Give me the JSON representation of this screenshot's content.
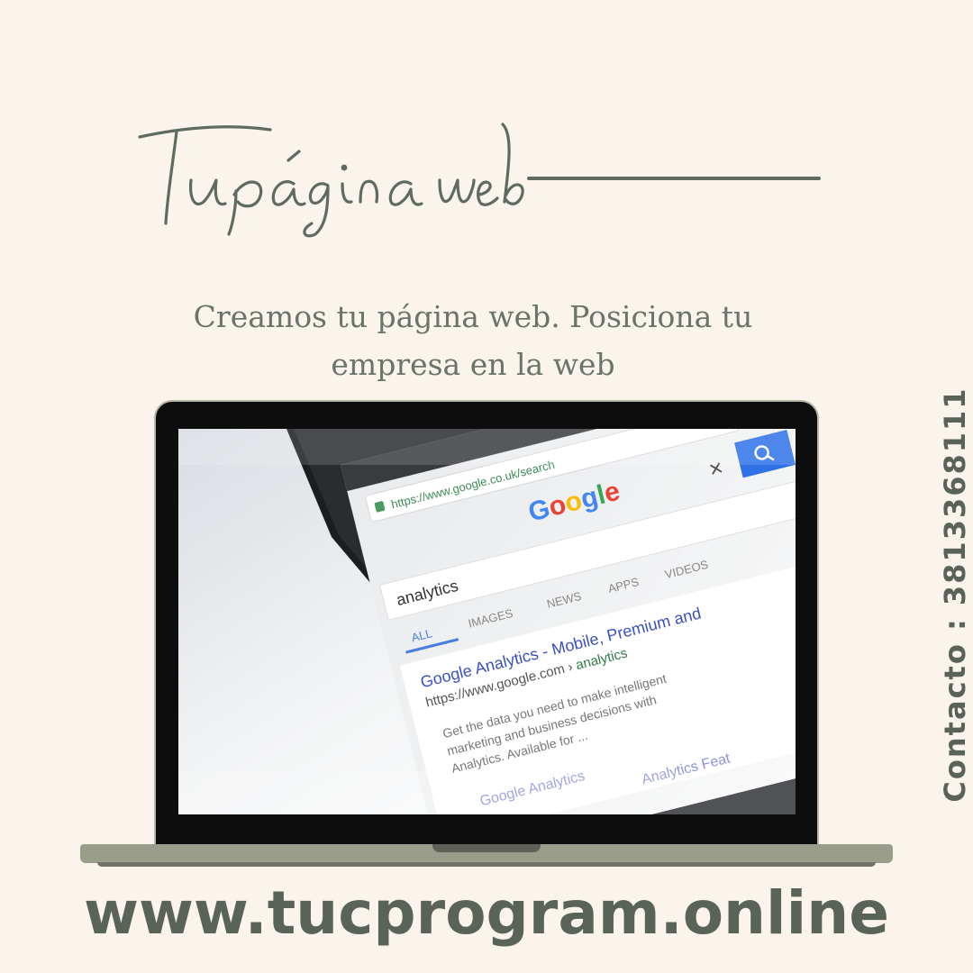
{
  "headline": "Tu página web",
  "subtitle": "Creamos tu página web. Posiciona tu empresa en la web",
  "contact": "Contacto : 3813368111",
  "website": "www.tucprogram.online",
  "phone_screen": {
    "address_bar": "https://www.google.co.uk/search",
    "logo": "Google",
    "query": "analytics",
    "tabs": [
      "ALL",
      "IMAGES",
      "NEWS",
      "APPS",
      "VIDEOS"
    ],
    "result_title": "Google Analytics - Mobile, Premium and",
    "result_url_base": "https://www.google.com › ",
    "result_url_path": "analytics",
    "result_snippet": [
      "Get the data you need to make intelligent",
      "marketing and business decisions with",
      "Analytics. Available for ..."
    ],
    "result_link_1": "Google Analytics",
    "result_link_2": "Analytics Feat"
  },
  "colors": {
    "background": "#faf4ec",
    "accent": "#5a6358",
    "laptop_base": "#9a9d8a"
  }
}
